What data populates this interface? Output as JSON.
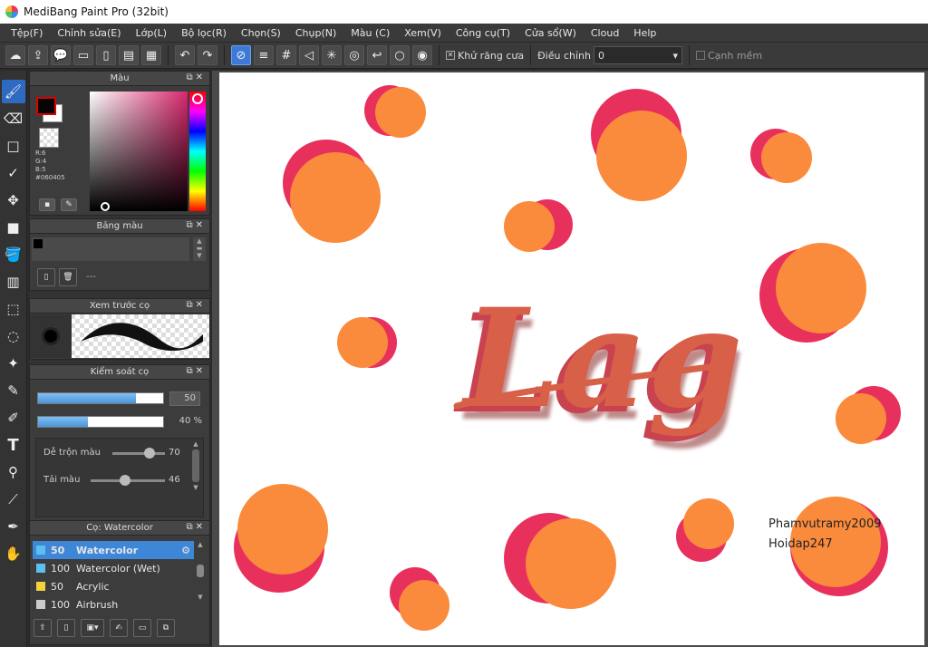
{
  "window": {
    "title": "MediBang Paint Pro (32bit)"
  },
  "menu": [
    "Tệp(F)",
    "Chỉnh sửa(E)",
    "Lớp(L)",
    "Bộ lọc(R)",
    "Chọn(S)",
    "Chụp(N)",
    "Màu (C)",
    "Xem(V)",
    "Công cụ(T)",
    "Cửa sổ(W)",
    "Cloud",
    "Help"
  ],
  "toolbar": {
    "antialias_label": "Khử răng cưa",
    "adjust_label": "Điều chỉnh",
    "adjust_value": "0",
    "edge_label": "Cạnh mềm"
  },
  "color_panel": {
    "title": "Màu",
    "r": "R:6",
    "g": "G:4",
    "b": "B:5",
    "hex": "#060405",
    "fg_color": "#060405",
    "bg_color": "#ffffff"
  },
  "palette_panel": {
    "title": "Bảng màu",
    "list_text": "---"
  },
  "preview_panel": {
    "title": "Xem trước cọ"
  },
  "brush_control": {
    "title": "Kiểm soát cọ",
    "size_value": "50",
    "size_fraction": 0.78,
    "opacity_value": "40 %",
    "opacity_fraction": 0.4,
    "mix_label": "Dễ trộn màu",
    "mix_value": "70",
    "mix_fraction": 0.7,
    "load_label": "Tải màu",
    "load_value": "46",
    "load_fraction": 0.46
  },
  "brush_panel": {
    "title": "Cọ: Watercolor",
    "items": [
      {
        "size": "50",
        "name": "Watercolor",
        "color": "#5bc0f0",
        "selected": true
      },
      {
        "size": "100",
        "name": "Watercolor (Wet)",
        "color": "#5bc0f0",
        "selected": false
      },
      {
        "size": "50",
        "name": "Acrylic",
        "color": "#f2d33a",
        "selected": false
      },
      {
        "size": "100",
        "name": "Airbrush",
        "color": "#cccccc",
        "selected": false
      }
    ]
  },
  "canvas": {
    "text_art": "Lag",
    "signature_line1": "Phamvutramy2009",
    "signature_line2": "Hoidap247",
    "dot_orange": "#fa8a3c",
    "dot_pink": "#e8305c",
    "lettering_color": "#d86048"
  }
}
